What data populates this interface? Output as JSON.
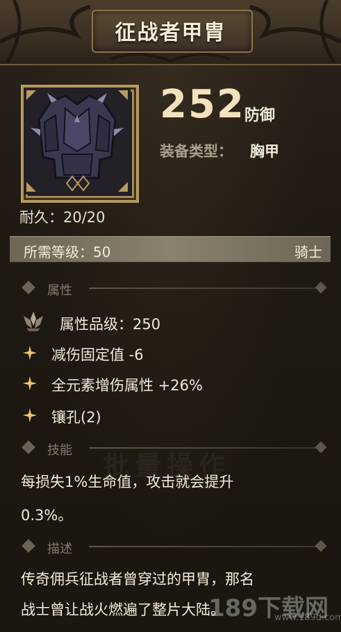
{
  "title": "征战者甲胄",
  "item": {
    "icon": "armor-chestplate-icon",
    "defense_value": "252",
    "defense_label": "防御",
    "type_label": "装备类型：",
    "type_value": "胸甲",
    "durability": "耐久：20/20",
    "required_level": "所需等级：50",
    "class": "骑士"
  },
  "sections": {
    "attributes": "属性",
    "skill": "技能",
    "description": "描述"
  },
  "attributes": {
    "quality": "属性品级：250",
    "items": [
      "减伤固定值 -6",
      "全元素增伤属性 +26%",
      "镶孔(2)"
    ]
  },
  "skill": {
    "line1": "每损失1%生命值，攻击就会提升",
    "line2": "0.3%。"
  },
  "description": {
    "line1": "传奇佣兵征战者曾穿过的甲胄，那名",
    "line2": "战士曾让战火燃遍了整片大陆。"
  },
  "background_text": "批量操作",
  "watermark": {
    "main": "189下载网",
    "sub": "www.189d.com"
  },
  "colors": {
    "gold_border": "#b79b5e",
    "defense_value": "#f3e3bd",
    "muted_label": "#a99f8c",
    "section_title": "#837b6c",
    "sparkle": "#f2c46a"
  }
}
